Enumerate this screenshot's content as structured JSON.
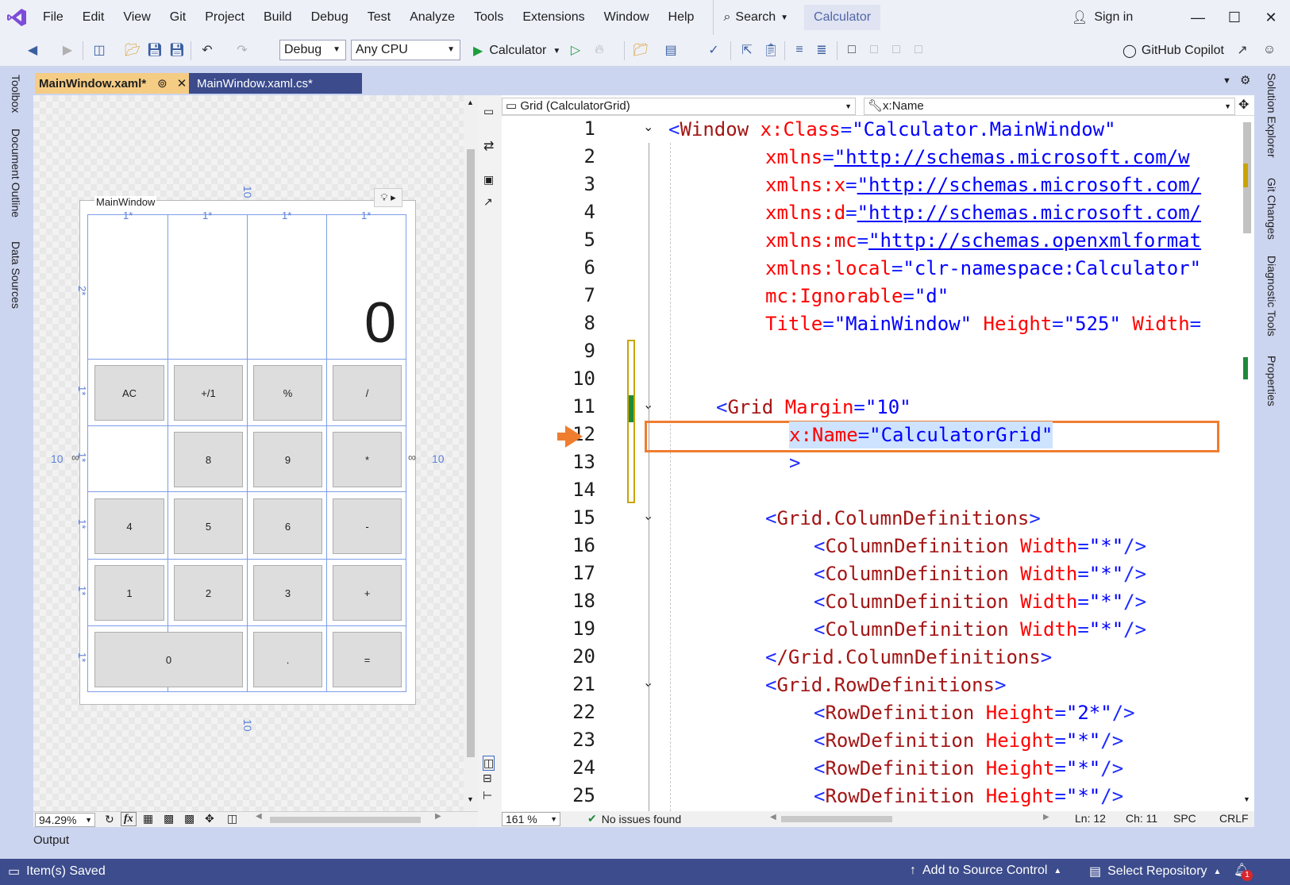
{
  "menu": {
    "items": [
      "File",
      "Edit",
      "View",
      "Git",
      "Project",
      "Build",
      "Debug",
      "Test",
      "Analyze",
      "Tools",
      "Extensions",
      "Window",
      "Help"
    ],
    "search_label": "Search",
    "solution_title": "Calculator",
    "sign_in": "Sign in"
  },
  "toolbar": {
    "config": "Debug",
    "platform": "Any CPU",
    "run_target": "Calculator",
    "copilot": "GitHub Copilot"
  },
  "left_rail": [
    "Toolbox",
    "Document Outline",
    "Data Sources"
  ],
  "right_rail": [
    "Solution Explorer",
    "Git Changes",
    "Diagnostic Tools",
    "Properties"
  ],
  "tabs": {
    "active": "MainWindow.xaml*",
    "inactive": "MainWindow.xaml.cs*"
  },
  "designer": {
    "window_title": "MainWindow",
    "display_value": "0",
    "margin_label": "10",
    "col_labels": [
      "1*",
      "1*",
      "1*",
      "1*"
    ],
    "row_labels": [
      "2*",
      "1*",
      "1*",
      "1*",
      "1*",
      "1*"
    ],
    "buttons": [
      "AC",
      "+/1",
      "%",
      "/",
      "8",
      "9",
      "*",
      "4",
      "5",
      "6",
      "-",
      "1",
      "2",
      "3",
      "+",
      "0",
      ".",
      "="
    ],
    "zoom": "94.29%",
    "fx_label": "fx"
  },
  "editor": {
    "scope": "Grid (CalculatorGrid)",
    "member": "x:Name",
    "zoom": "161 %",
    "issues": "No issues found",
    "ln": "Ln: 12",
    "ch": "Ch: 11",
    "spc": "SPC",
    "crlf": "CRLF",
    "line_numbers": [
      "1",
      "2",
      "3",
      "4",
      "5",
      "6",
      "7",
      "8",
      "9",
      "10",
      "11",
      "12",
      "13",
      "14",
      "15",
      "16",
      "17",
      "18",
      "19",
      "20",
      "21",
      "22",
      "23",
      "24",
      "25"
    ],
    "lines": {
      "l1_tag": "Window",
      "l1_attr": "x:Class",
      "l1_val": "\"Calculator.MainWindow\"",
      "l2_attr": "xmlns",
      "l2_val": "\"http://schemas.microsoft.com/w",
      "l3_attr": "xmlns:x",
      "l3_val": "\"http://schemas.microsoft.com/",
      "l4_attr": "xmlns:d",
      "l4_val": "\"http://schemas.microsoft.com/",
      "l5_attr": "xmlns:mc",
      "l5_val": "\"http://schemas.openxmlformat",
      "l6_attr": "xmlns:local",
      "l6_val": "\"clr-namespace:Calculator\"",
      "l7_attr": "mc:Ignorable",
      "l7_val": "\"d\"",
      "l8_attr1": "Title",
      "l8_val1": "\"MainWindow\"",
      "l8_attr2": "Height",
      "l8_val2": "\"525\"",
      "l8_attr3": "Width",
      "l11_tag": "Grid",
      "l11_attr": "Margin",
      "l11_val": "\"10\"",
      "l12_attr": "x:Name",
      "l12_val": "\"CalculatorGrid\"",
      "l13": ">",
      "l15_tag": "Grid.ColumnDefinitions",
      "coldef_tag": "ColumnDefinition",
      "coldef_attr": "Width",
      "coldef_val": "\"*\"",
      "l20_tag": "/Grid.ColumnDefinitions",
      "l21_tag": "Grid.RowDefinitions",
      "rowdef_tag": "RowDefinition",
      "rowdef_attr": "Height",
      "rowdef_val_first": "\"2*\"",
      "rowdef_val": "\"*\""
    }
  },
  "output_label": "Output",
  "status": {
    "saved": "Item(s) Saved",
    "source_control": "Add to Source Control",
    "repository": "Select Repository",
    "notifications": "1"
  }
}
